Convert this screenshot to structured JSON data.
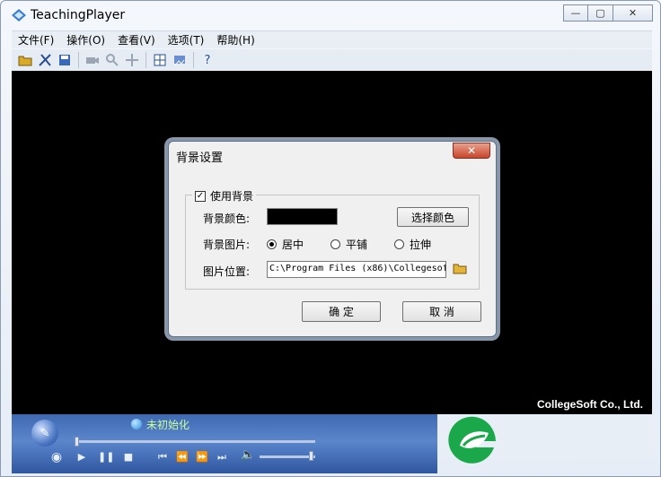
{
  "window": {
    "title": "TeachingPlayer",
    "buttons": {
      "minimize": "—",
      "maximize": "▢",
      "close": "✕"
    }
  },
  "menu": [
    "文件(F)",
    "操作(O)",
    "查看(V)",
    "选项(T)",
    "帮助(H)"
  ],
  "toolbar": {
    "icons": [
      "open-folder-icon",
      "tools-icon",
      "save-icon",
      "camera-icon",
      "zoom-icon",
      "move-icon",
      "grid-icon",
      "settings-icon",
      "help-icon"
    ],
    "help_glyph": "?"
  },
  "video": {
    "watermark": "CollegeSoft Co., Ltd."
  },
  "player": {
    "status": "未初始化"
  },
  "dialog": {
    "title": "背景设置",
    "close_glyph": "✕",
    "use_background": {
      "label": "使用背景",
      "checked": true
    },
    "color_label": "背景颜色:",
    "color_value": "#000000",
    "choose_color_button": "选择颜色",
    "image_label": "背景图片:",
    "image_options": [
      {
        "label": "居中",
        "selected": true
      },
      {
        "label": "平铺",
        "selected": false
      },
      {
        "label": "拉伸",
        "selected": false
      }
    ],
    "location_label": "图片位置:",
    "location_value": "C:\\Program Files (x86)\\Collegesof",
    "ok_button": "确 定",
    "cancel_button": "取 消"
  },
  "colors": {
    "accent": "#3f68b0",
    "status_text": "#c9ff9e",
    "brand_green": "#1aa84a"
  }
}
